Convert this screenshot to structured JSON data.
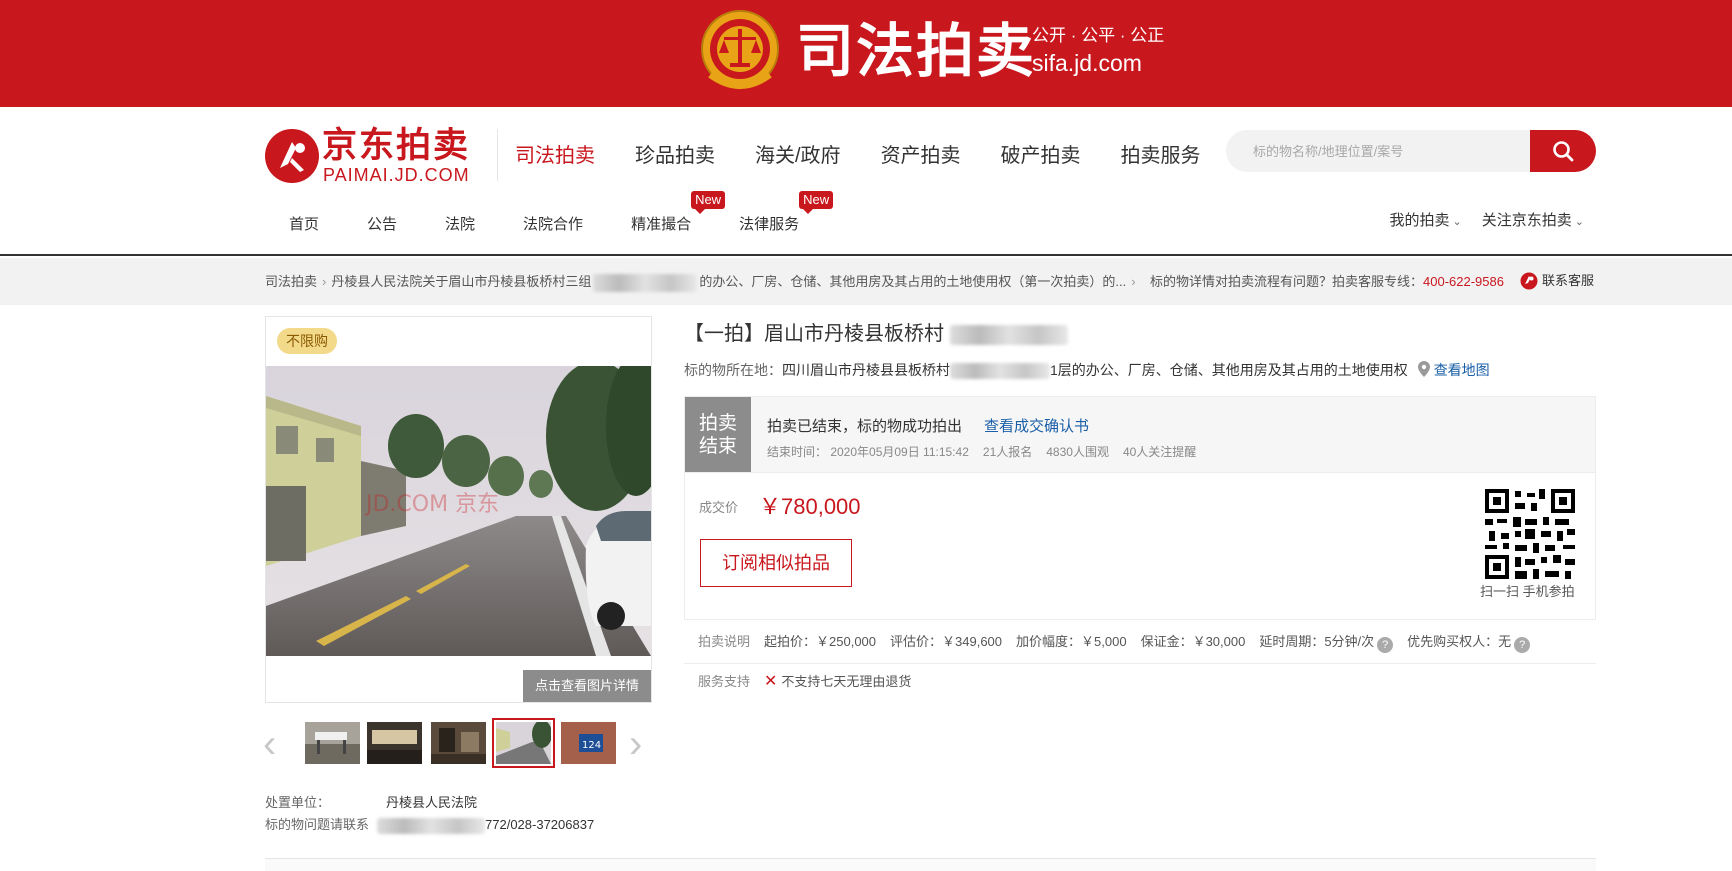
{
  "banner": {
    "title": "司法拍卖",
    "slogan": "公开 · 公平 · 公正",
    "domain": "sifa.jd.com"
  },
  "logo": {
    "cn": "京东拍卖",
    "en": "PAIMAI.JD.COM"
  },
  "main_nav": [
    "司法拍卖",
    "珍品拍卖",
    "海关/政府",
    "资产拍卖",
    "破产拍卖",
    "拍卖服务"
  ],
  "search": {
    "placeholder": "标的物名称/地理位置/案号"
  },
  "sub_nav": [
    {
      "label": "首页"
    },
    {
      "label": "公告"
    },
    {
      "label": "法院"
    },
    {
      "label": "法院合作"
    },
    {
      "label": "精准撮合",
      "badge": "New"
    },
    {
      "label": "法律服务",
      "badge": "New"
    }
  ],
  "user_nav": [
    "我的拍卖",
    "关注京东拍卖"
  ],
  "breadcrumb": {
    "root": "司法拍卖",
    "title_start": "丹棱县人民法院关于眉山市丹棱县板桥村三组",
    "title_end": "的办公、厂房、仓储、其他用房及其占用的土地使用权（第一次拍卖）的...",
    "help_text": "标的物详情对拍卖流程有问题？拍卖客服专线：",
    "phone": "400-622-9586",
    "service": "联系客服"
  },
  "gallery": {
    "badge": "不限购",
    "watermark": "JD.COM 京东",
    "detail_button": "点击查看图片详情",
    "thumb_label": "124"
  },
  "disposal": {
    "unit_label": "处置单位：",
    "unit_value": "丹棱县人民法院",
    "contact_label": "标的物问题请联系",
    "contact_value": "772/028-37206837"
  },
  "item": {
    "title": "【一拍】眉山市丹棱县板桥村",
    "location_label": "标的物所在地：",
    "location_start": "四川眉山市丹棱县县板桥村",
    "location_end": "1层的办公、厂房、仓储、其他用房及其占用的土地使用权",
    "map_link": "查看地图"
  },
  "status": {
    "tag": "拍卖结束",
    "text": "拍卖已结束，标的物成功拍出",
    "link": "查看成交确认书",
    "end_time": "结束时间： 2020年05月09日 11:15:42",
    "signups": "21人报名",
    "viewers": "4830人围观",
    "followers": "40人关注提醒"
  },
  "deal": {
    "label": "成交价",
    "price": "￥780,000",
    "subscribe": "订阅相似拍品",
    "qr_caption": "扫一扫 手机参拍"
  },
  "terms": {
    "label": "拍卖说明",
    "start_price": "起拍价：￥250,000",
    "appraisal": "评估价：￥349,600",
    "increment": "加价幅度：￥5,000",
    "deposit": "保证金：￥30,000",
    "delay": "延时周期：5分钟/次",
    "priority": "优先购买权人：无"
  },
  "service": {
    "label": "服务支持",
    "text": "不支持七天无理由退货"
  },
  "colors": {
    "brand_red": "#c9171e",
    "link_blue": "#1a5fa8"
  }
}
